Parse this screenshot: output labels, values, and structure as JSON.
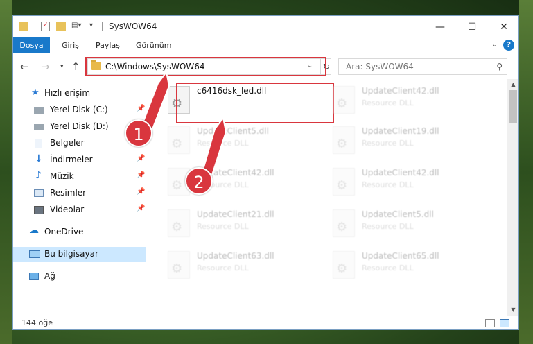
{
  "window": {
    "title": "SysWOW64",
    "minimize_glyph": "—",
    "maximize_glyph": "☐",
    "close_glyph": "✕"
  },
  "ribbon": {
    "tabs": [
      {
        "label": "Dosya",
        "active": true
      },
      {
        "label": "Giriş"
      },
      {
        "label": "Paylaş"
      },
      {
        "label": "Görünüm"
      }
    ],
    "help_label": "?"
  },
  "address": {
    "path": "C:\\Windows\\SysWOW64",
    "search_placeholder": "Ara: SysWOW64"
  },
  "nav_pane": {
    "items": [
      {
        "label": "Hızlı erişim",
        "icon": "star-icon",
        "pinned": false
      },
      {
        "label": "Yerel Disk (C:)",
        "icon": "drive-icon",
        "pinned": true
      },
      {
        "label": "Yerel Disk (D:)",
        "icon": "drive-icon",
        "pinned": false
      },
      {
        "label": "Belgeler",
        "icon": "documents-icon",
        "pinned": true
      },
      {
        "label": "İndirmeler",
        "icon": "download-icon",
        "pinned": true
      },
      {
        "label": "Müzik",
        "icon": "music-icon",
        "pinned": true
      },
      {
        "label": "Resimler",
        "icon": "pictures-icon",
        "pinned": true
      },
      {
        "label": "Videolar",
        "icon": "videos-icon",
        "pinned": true
      },
      {
        "label": "OneDrive",
        "icon": "cloud-icon",
        "pinned": false
      },
      {
        "label": "Bu bilgisayar",
        "icon": "computer-icon",
        "pinned": false,
        "selected": true
      },
      {
        "label": "Ağ",
        "icon": "network-icon",
        "pinned": false
      }
    ],
    "pin_glyph": "📌"
  },
  "files": {
    "highlighted": {
      "name": "c6416dsk_led.dll"
    },
    "left_column": [
      {
        "name": "UpdateClient5.dll",
        "type": "Resource DLL"
      },
      {
        "name": "UpdateClient42.dll",
        "type": "Resource DLL"
      },
      {
        "name": "UpdateClient21.dll",
        "type": "Resource DLL"
      },
      {
        "name": "UpdateClient63.dll",
        "type": "Resource DLL"
      }
    ],
    "right_column": [
      {
        "name": "UpdateClient42.dll",
        "type": "Resource DLL"
      },
      {
        "name": "UpdateClient19.dll",
        "type": "Resource DLL"
      },
      {
        "name": "UpdateClient42.dll",
        "type": "Resource DLL"
      },
      {
        "name": "UpdateClient5.dll",
        "type": "Resource DLL"
      },
      {
        "name": "UpdateClient65.dll",
        "type": "Resource DLL"
      }
    ]
  },
  "status": {
    "item_count": "144 öğe"
  },
  "callouts": {
    "one": "1",
    "two": "2"
  },
  "colors": {
    "accent": "#1979ca",
    "callout": "#d9363e",
    "selected": "#cce8ff"
  }
}
